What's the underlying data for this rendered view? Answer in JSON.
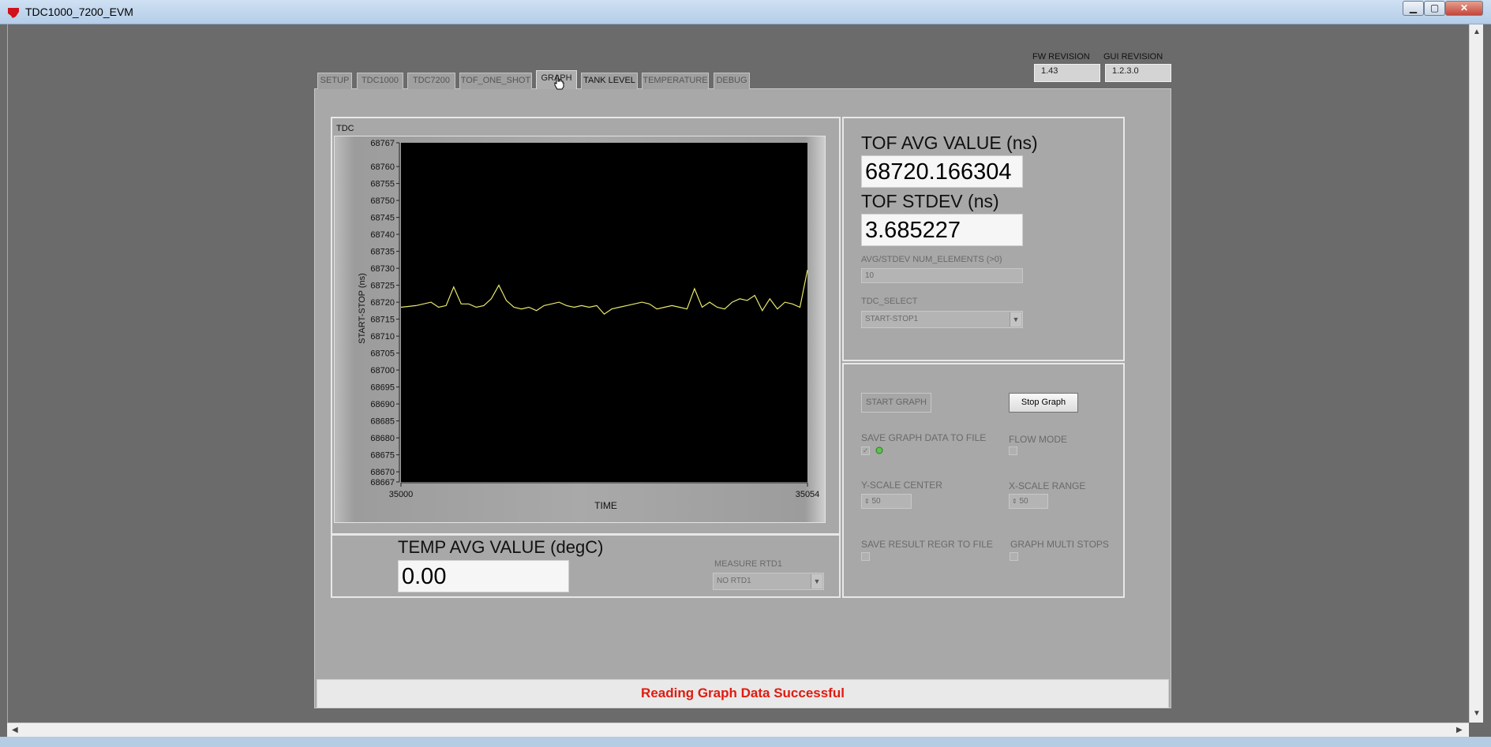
{
  "window": {
    "title": "TDC1000_7200_EVM"
  },
  "tabs": [
    "SETUP",
    "TDC1000",
    "TDC7200",
    "TOF_ONE_SHOT",
    "GRAPH",
    "TANK LEVEL",
    "TEMPERATURE",
    "DEBUG"
  ],
  "active_tab": "GRAPH",
  "revisions": {
    "fw_label": "FW REVISION",
    "fw_value": "1.43",
    "gui_label": "GUI REVISION",
    "gui_value": "1.2.3.0"
  },
  "graph": {
    "label": "TDC"
  },
  "tof": {
    "avg_label": "TOF AVG VALUE (ns)",
    "avg_value": "68720.166304",
    "stdev_label": "TOF STDEV (ns)",
    "stdev_value": "3.685227",
    "num_elements_label": "AVG/STDEV NUM_ELEMENTS (>0)",
    "num_elements_value": "10",
    "tdc_select_label": "TDC_SELECT",
    "tdc_select_value": "START-STOP1"
  },
  "controls": {
    "start_graph": "START GRAPH",
    "stop_graph": "Stop Graph",
    "save_graph_label": "SAVE GRAPH DATA TO FILE",
    "flow_mode_label": "FLOW MODE",
    "y_scale_label": "Y-SCALE CENTER",
    "y_scale_value": "50",
    "x_scale_label": "X-SCALE RANGE",
    "x_scale_value": "50",
    "save_result_label": "SAVE RESULT REGR TO FILE",
    "multi_stops_label": "GRAPH MULTI STOPS",
    "checked_glyph": "✓",
    "stepper_glyph": "⇕"
  },
  "temp": {
    "avg_label": "TEMP AVG VALUE (degC)",
    "avg_value": "0.00",
    "rtd_label": "MEASURE RTD1",
    "rtd_value": "NO RTD1"
  },
  "status": {
    "message": "Reading Graph Data Successful"
  },
  "chart_data": {
    "type": "line",
    "xlabel": "TIME",
    "ylabel": "START-STOP (ns)",
    "xlim": [
      35000,
      35054
    ],
    "ylim": [
      68667,
      68767
    ],
    "x_tick_labels": [
      "35000",
      "35054"
    ],
    "y_tick_labels": [
      "68767",
      "68760",
      "68755",
      "68750",
      "68745",
      "68740",
      "68735",
      "68730",
      "68725",
      "68720",
      "68715",
      "68710",
      "68705",
      "68700",
      "68695",
      "68690",
      "68685",
      "68680",
      "68675",
      "68670",
      "68667"
    ],
    "y_ticks": [
      68767,
      68760,
      68755,
      68750,
      68745,
      68740,
      68735,
      68730,
      68725,
      68720,
      68715,
      68710,
      68705,
      68700,
      68695,
      68690,
      68685,
      68680,
      68675,
      68670,
      68667
    ],
    "line_color": "#e8e86a",
    "background": "#000000",
    "series": [
      {
        "x": [
          35000,
          35002,
          35004,
          35005,
          35006,
          35007,
          35008,
          35009,
          35010,
          35011,
          35012,
          35013,
          35014,
          35015,
          35016,
          35017,
          35018,
          35019,
          35020,
          35021,
          35022,
          35023,
          35024,
          35025,
          35026,
          35027,
          35028,
          35029,
          35030,
          35031,
          35032,
          35033,
          35034,
          35035,
          35036,
          35037,
          35038,
          35039,
          35040,
          35041,
          35042,
          35043,
          35044,
          35045,
          35046,
          35047,
          35048,
          35049,
          35050,
          35051,
          35052,
          35053,
          35054
        ],
        "y": [
          68718.5,
          68719,
          68720,
          68718.5,
          68719,
          68724.5,
          68719.5,
          68719.5,
          68718.5,
          68719,
          68721,
          68725,
          68720.5,
          68718.5,
          68718,
          68718.5,
          68717.5,
          68719,
          68719.5,
          68720,
          68719,
          68718.5,
          68719,
          68718.5,
          68719,
          68716.5,
          68718,
          68718.5,
          68719,
          68719.5,
          68720,
          68719.5,
          68718,
          68718.5,
          68719,
          68718.5,
          68718,
          68724,
          68718.5,
          68720,
          68718.5,
          68718,
          68720,
          68721,
          68720.5,
          68722,
          68717.5,
          68721,
          68718,
          68720,
          68719.5,
          68718.5,
          68729.5
        ]
      }
    ]
  }
}
